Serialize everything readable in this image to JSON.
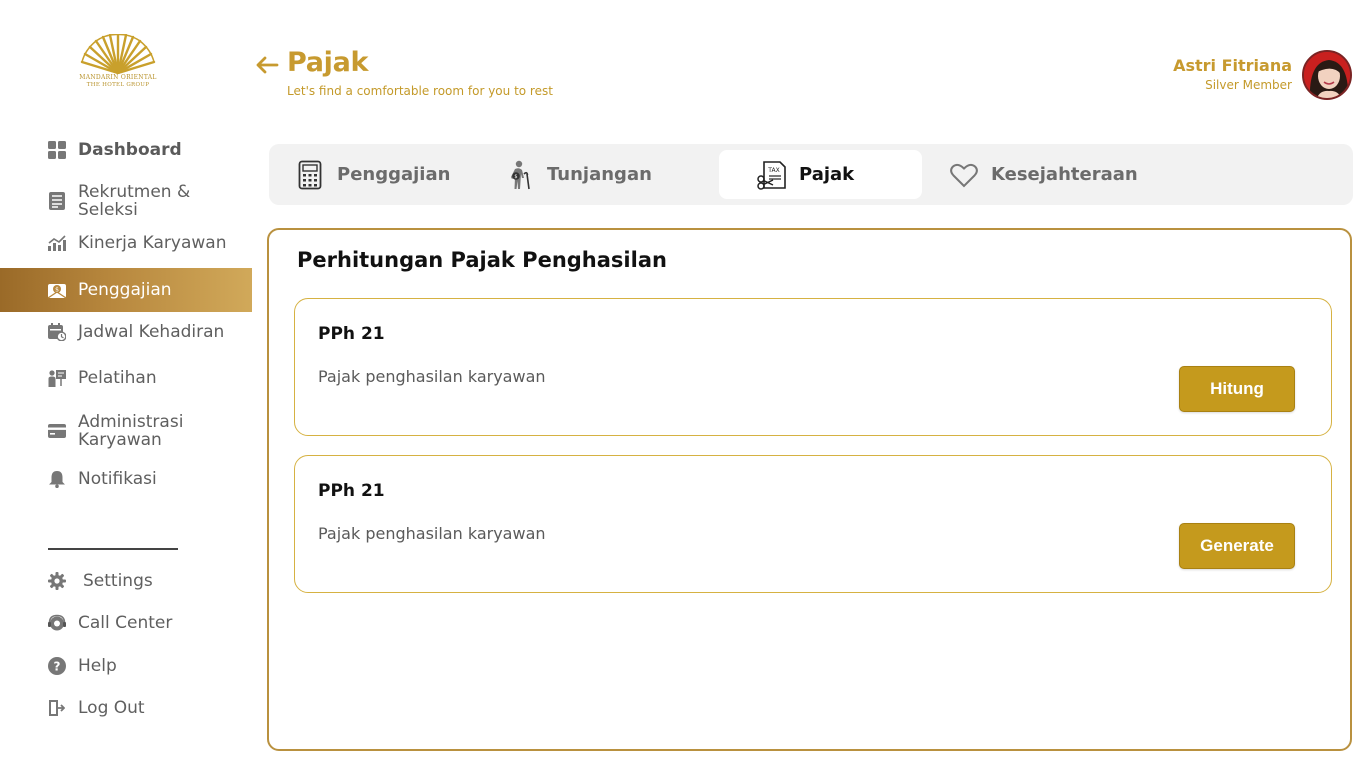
{
  "brand": {
    "logo_line1": "MANDARIN ORIENTAL",
    "logo_line2": "THE HOTEL GROUP",
    "accent_color": "#c79a2f"
  },
  "sidebar": {
    "items": [
      {
        "label": "Dashboard",
        "icon": "dashboard-grid-icon"
      },
      {
        "label": "Rekrutmen & Seleksi",
        "icon": "document-list-icon"
      },
      {
        "label": "Kinerja Karyawan",
        "icon": "chart-trend-icon"
      },
      {
        "label": "Penggajian",
        "icon": "payroll-envelope-icon",
        "active": true
      },
      {
        "label": "Jadwal Kehadiran",
        "icon": "calendar-clock-icon"
      },
      {
        "label": "Pelatihan",
        "icon": "training-board-icon"
      },
      {
        "label": "Administrasi Karyawan",
        "icon": "card-icon"
      },
      {
        "label": "Notifikasi",
        "icon": "bell-icon"
      }
    ],
    "footer_items": [
      {
        "label": "Settings",
        "icon": "gear-icon"
      },
      {
        "label": "Call Center",
        "icon": "headset-icon"
      },
      {
        "label": "Help",
        "icon": "help-circle-icon"
      },
      {
        "label": "Log Out",
        "icon": "logout-icon"
      }
    ]
  },
  "header": {
    "title": "Pajak",
    "subtitle": "Let's find a comfortable room for you to rest",
    "back_icon": "arrow-left-icon"
  },
  "user": {
    "name": "Astri Fitriana",
    "tier": "Silver Member"
  },
  "tabs": [
    {
      "label": "Penggajian",
      "icon": "calculator-icon"
    },
    {
      "label": "Tunjangan",
      "icon": "person-cane-icon"
    },
    {
      "label": "Pajak",
      "icon": "tax-scissors-icon",
      "active": true
    },
    {
      "label": "Kesejahteraan",
      "icon": "heart-icon"
    }
  ],
  "panel": {
    "title": "Perhitungan Pajak Penghasilan",
    "cards": [
      {
        "title": "PPh 21",
        "description": "Pajak penghasilan karyawan",
        "button": "Hitung"
      },
      {
        "title": "PPh 21",
        "description": "Pajak penghasilan karyawan",
        "button": "Generate"
      }
    ]
  }
}
